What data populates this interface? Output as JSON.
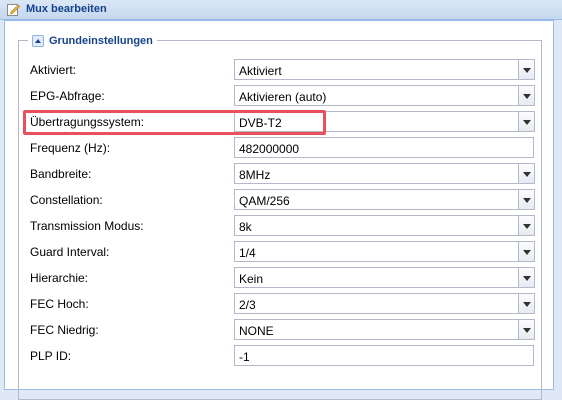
{
  "window": {
    "title": "Mux bearbeiten",
    "icon": "edit-icon"
  },
  "section": {
    "legend": "Grundeinstellungen"
  },
  "fields": [
    {
      "label": "Aktiviert:",
      "value": "Aktiviert",
      "type": "select"
    },
    {
      "label": "EPG-Abfrage:",
      "value": "Aktivieren (auto)",
      "type": "select"
    },
    {
      "label": "Übertragungssystem:",
      "value": "DVB-T2",
      "type": "select"
    },
    {
      "label": "Frequenz (Hz):",
      "value": "482000000",
      "type": "text"
    },
    {
      "label": "Bandbreite:",
      "value": "8MHz",
      "type": "select"
    },
    {
      "label": "Constellation:",
      "value": "QAM/256",
      "type": "select"
    },
    {
      "label": "Transmission Modus:",
      "value": "8k",
      "type": "select"
    },
    {
      "label": "Guard Interval:",
      "value": "1/4",
      "type": "select"
    },
    {
      "label": "Hierarchie:",
      "value": "Kein",
      "type": "select"
    },
    {
      "label": "FEC Hoch:",
      "value": "2/3",
      "type": "select"
    },
    {
      "label": "FEC Niedrig:",
      "value": "NONE",
      "type": "select"
    },
    {
      "label": "PLP ID:",
      "value": "-1",
      "type": "text"
    }
  ],
  "colors": {
    "highlight": "#e8505b",
    "title": "#15428b"
  }
}
